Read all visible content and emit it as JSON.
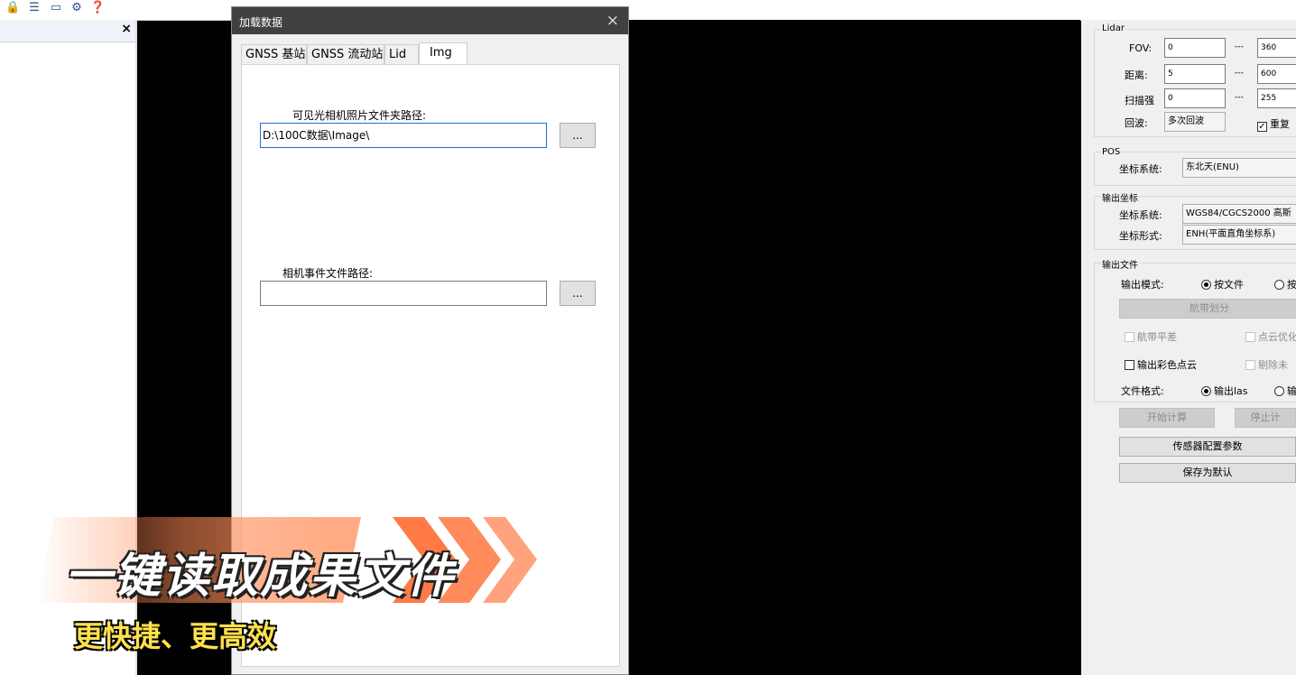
{
  "toolbar": {
    "icons": [
      "lock-icon",
      "list-icon",
      "laptop-icon",
      "gear-icon",
      "help-icon"
    ]
  },
  "left_panel": {
    "close_glyph": "×"
  },
  "dialog": {
    "title": "加载数据",
    "close_glyph": "×",
    "tabs": [
      {
        "label": "GNSS 基站",
        "active": false
      },
      {
        "label": "GNSS 流动站",
        "active": false
      },
      {
        "label": "Lid",
        "active": false
      },
      {
        "label": "Img",
        "active": true
      }
    ],
    "img": {
      "photo_folder_label": "可见光相机照片文件夹路径:",
      "photo_folder_value": "D:\\100C数据\\Image\\",
      "browse_label": "...",
      "event_file_label": "相机事件文件路径:",
      "event_file_value": ""
    }
  },
  "right_panel": {
    "lidar": {
      "title": "Lidar",
      "fov_label": "FOV:",
      "fov_min": "0",
      "fov_max": "360",
      "dist_label": "距离:",
      "dist_min": "5",
      "dist_max": "600",
      "intensity_label": "扫描强",
      "intensity_min": "0",
      "intensity_max": "255",
      "sep": "---",
      "echo_label": "回波:",
      "echo_value": "多次回波",
      "repeat_label": "重复"
    },
    "pos": {
      "title": "POS",
      "coord_label": "坐标系统:",
      "coord_value": "东北天(ENU)"
    },
    "output_coord": {
      "title": "输出坐标",
      "coord_label": "坐标系统:",
      "coord_value": "WGS84/CGCS2000 高斯",
      "form_label": "坐标形式:",
      "form_value": "ENH(平面直角坐标系)"
    },
    "output_file": {
      "title": "输出文件",
      "mode_label": "输出模式:",
      "mode_opt1": "按文件",
      "mode_opt2": "按",
      "strip_button": "航带划分",
      "strip_adjust": "航带平差",
      "pc_optimize": "点云优化",
      "color_pc": "输出彩色点云",
      "remove": "剔除未",
      "format_label": "文件格式:",
      "format_opt1": "输出las",
      "format_opt2": "输"
    },
    "start_button": "开始计算",
    "stop_button": "停止计",
    "sensor_button": "传感器配置参数",
    "save_default_button": "保存为默认"
  },
  "overlay": {
    "headline": "一键读取成果文件",
    "subline": "更快捷、更高效"
  }
}
